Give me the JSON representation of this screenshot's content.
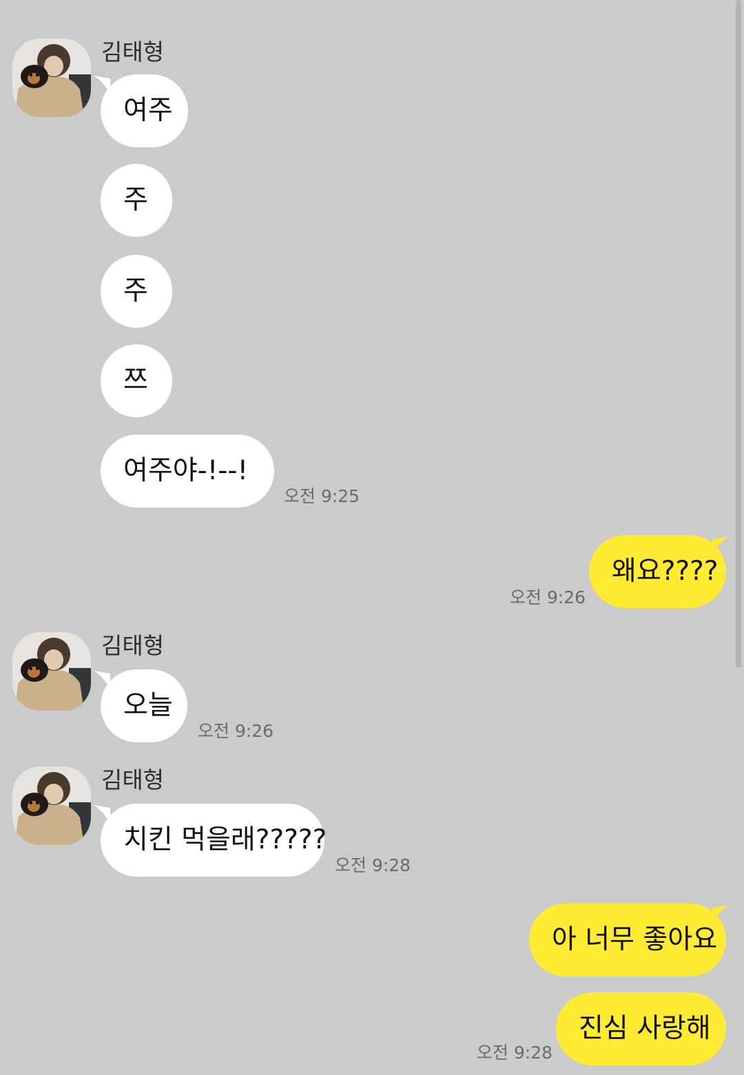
{
  "sender_name": "김태형",
  "messages": {
    "m1": "여주",
    "m2": "주",
    "m3": "주",
    "m4": "쯔",
    "m5": "여주야-!--!",
    "m6": "왜요????",
    "m7": "오늘",
    "m8": "치킨 먹을래?????",
    "m9": "아 너무 좋아요",
    "m10": "진심 사랑해"
  },
  "times": {
    "t1": "오전 9:25",
    "t2": "오전 9:26",
    "t3": "오전 9:26",
    "t4": "오전 9:28",
    "t5": "오전 9:28"
  },
  "colors": {
    "background": "#cbcbcb",
    "incoming_bubble": "#ffffff",
    "outgoing_bubble": "#ffeb33"
  }
}
